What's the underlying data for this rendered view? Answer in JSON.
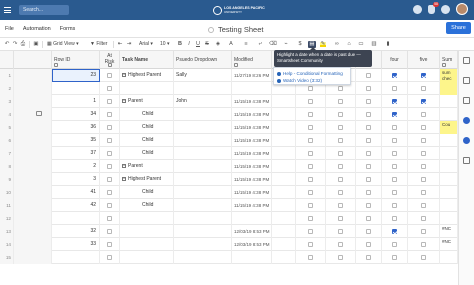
{
  "topbar": {
    "search_placeholder": "Search...",
    "logo_line1": "LOS ANGELES PACIFIC",
    "logo_line2": "UNIVERSITY",
    "notification_count": "58",
    "brand_color": "#2a5a8f"
  },
  "menubar": {
    "items": [
      "File",
      "Automation",
      "Forms"
    ],
    "sheet_title": "Testing Sheet",
    "share_label": "Share"
  },
  "toolbar": {
    "view_label": "Grid View",
    "filter_label": "Filter",
    "font_label": "Arial",
    "size_label": "10"
  },
  "tooltip": {
    "line1": "Highlight a date when a date is past due —",
    "line2": "Smartsheet Community"
  },
  "help_popup": {
    "link1": "Help - Conditional Formatting",
    "link2": "Watch Video (3:32)"
  },
  "columns": {
    "row_id": "Row ID",
    "at_risk": "At Risk",
    "task_name": "Task Name",
    "dropdown": "Psuedo Dropdown",
    "modified": "Modified",
    "four": "four",
    "five": "five",
    "sum": "Sum"
  },
  "rows": [
    {
      "n": "1",
      "id": "23",
      "task": "Highest Parent",
      "type": "parent",
      "dropdown": "Sally",
      "modified": "11/27/19 8:26 PM",
      "cb": [
        false,
        false,
        false,
        true,
        true
      ],
      "sum": "sum chec",
      "sum_yellow": true
    },
    {
      "n": "2",
      "id": "",
      "task": "",
      "type": "blank",
      "dropdown": "",
      "modified": "",
      "cb": [
        false,
        false,
        false,
        false,
        false
      ],
      "sum": "",
      "sum_yellow": true
    },
    {
      "n": "3",
      "id": "1",
      "task": "Parent",
      "type": "parent2",
      "dropdown": "John",
      "modified": "11/15/19 4:38 PM",
      "cb": [
        false,
        false,
        false,
        true,
        true
      ],
      "sum": "",
      "sum_yellow": false
    },
    {
      "n": "4",
      "id": "34",
      "task": "Child",
      "type": "child",
      "dropdown": "",
      "modified": "11/15/19 4:38 PM",
      "cb": [
        false,
        false,
        false,
        true,
        false
      ],
      "sum": "",
      "sum_yellow": false
    },
    {
      "n": "5",
      "id": "36",
      "task": "Child",
      "type": "child",
      "dropdown": "",
      "modified": "11/15/19 4:38 PM",
      "cb": [
        false,
        false,
        false,
        false,
        false
      ],
      "sum": "Cou",
      "sum_yellow": true
    },
    {
      "n": "6",
      "id": "35",
      "task": "Child",
      "type": "child",
      "dropdown": "",
      "modified": "11/15/19 4:38 PM",
      "cb": [
        false,
        false,
        false,
        false,
        false
      ],
      "sum": "",
      "sum_yellow": false
    },
    {
      "n": "7",
      "id": "37",
      "task": "Child",
      "type": "child",
      "dropdown": "",
      "modified": "11/15/19 4:38 PM",
      "cb": [
        false,
        false,
        false,
        false,
        false
      ],
      "sum": "",
      "sum_yellow": false
    },
    {
      "n": "8",
      "id": "2",
      "task": "Parent",
      "type": "parent2",
      "dropdown": "",
      "modified": "11/15/19 4:38 PM",
      "cb": [
        false,
        false,
        false,
        false,
        false
      ],
      "sum": "",
      "sum_yellow": false
    },
    {
      "n": "9",
      "id": "3",
      "task": "Highest Parent",
      "type": "parent2",
      "dropdown": "",
      "modified": "11/15/19 4:38 PM",
      "cb": [
        false,
        false,
        false,
        false,
        false
      ],
      "sum": "",
      "sum_yellow": false
    },
    {
      "n": "10",
      "id": "41",
      "task": "Child",
      "type": "child",
      "dropdown": "",
      "modified": "11/15/19 4:38 PM",
      "cb": [
        false,
        false,
        false,
        false,
        false
      ],
      "sum": "",
      "sum_yellow": false
    },
    {
      "n": "11",
      "id": "42",
      "task": "Child",
      "type": "child",
      "dropdown": "",
      "modified": "11/15/19 4:38 PM",
      "cb": [
        false,
        false,
        false,
        false,
        false
      ],
      "sum": "",
      "sum_yellow": false
    },
    {
      "n": "12",
      "id": "",
      "task": "",
      "type": "blank",
      "dropdown": "",
      "modified": "",
      "cb": [
        false,
        false,
        false,
        false,
        false
      ],
      "sum": "",
      "sum_yellow": false
    },
    {
      "n": "13",
      "id": "32",
      "task": "",
      "type": "blank",
      "dropdown": "",
      "modified": "12/03/19 8:53 PM",
      "cb": [
        false,
        false,
        false,
        true,
        false
      ],
      "sum": "#NC",
      "sum_yellow": false
    },
    {
      "n": "14",
      "id": "33",
      "task": "",
      "type": "blank",
      "dropdown": "",
      "modified": "12/03/19 8:53 PM",
      "cb": [
        false,
        false,
        false,
        false,
        false
      ],
      "sum": "#NC",
      "sum_yellow": false
    },
    {
      "n": "15",
      "id": "",
      "task": "",
      "type": "blank",
      "dropdown": "",
      "modified": "",
      "cb": [
        false,
        false,
        false,
        false,
        false
      ],
      "sum": "",
      "sum_yellow": false
    }
  ]
}
